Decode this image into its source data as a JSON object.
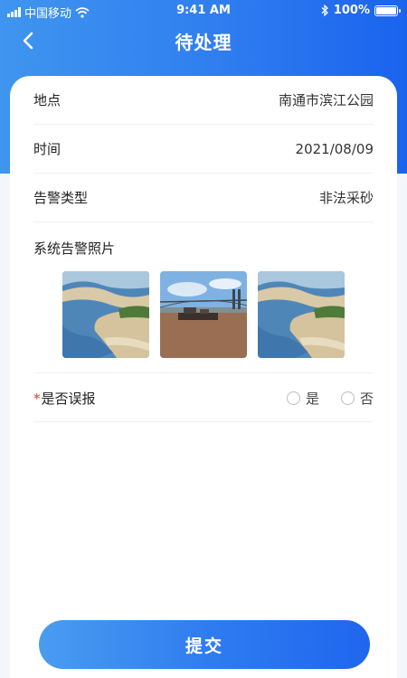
{
  "status_bar": {
    "carrier": "中国移动",
    "time": "9:41 AM",
    "battery": "100%"
  },
  "nav": {
    "title": "待处理"
  },
  "details": [
    {
      "label": "地点",
      "value": "南通市滨江公园"
    },
    {
      "label": "时间",
      "value": "2021/08/09"
    },
    {
      "label": "告警类型",
      "value": "非法采砂"
    }
  ],
  "photos": {
    "label": "系统告警照片",
    "items": [
      "river-bank-photo",
      "bridge-boat-photo",
      "river-bank-photo"
    ]
  },
  "false_alarm": {
    "required_mark": "*",
    "label": "是否误报",
    "options": [
      "是",
      "否"
    ]
  },
  "submit": {
    "label": "提交"
  },
  "colors": {
    "primary": "#2f7df0",
    "required": "#e0362e",
    "background": "#f3f6fb"
  }
}
